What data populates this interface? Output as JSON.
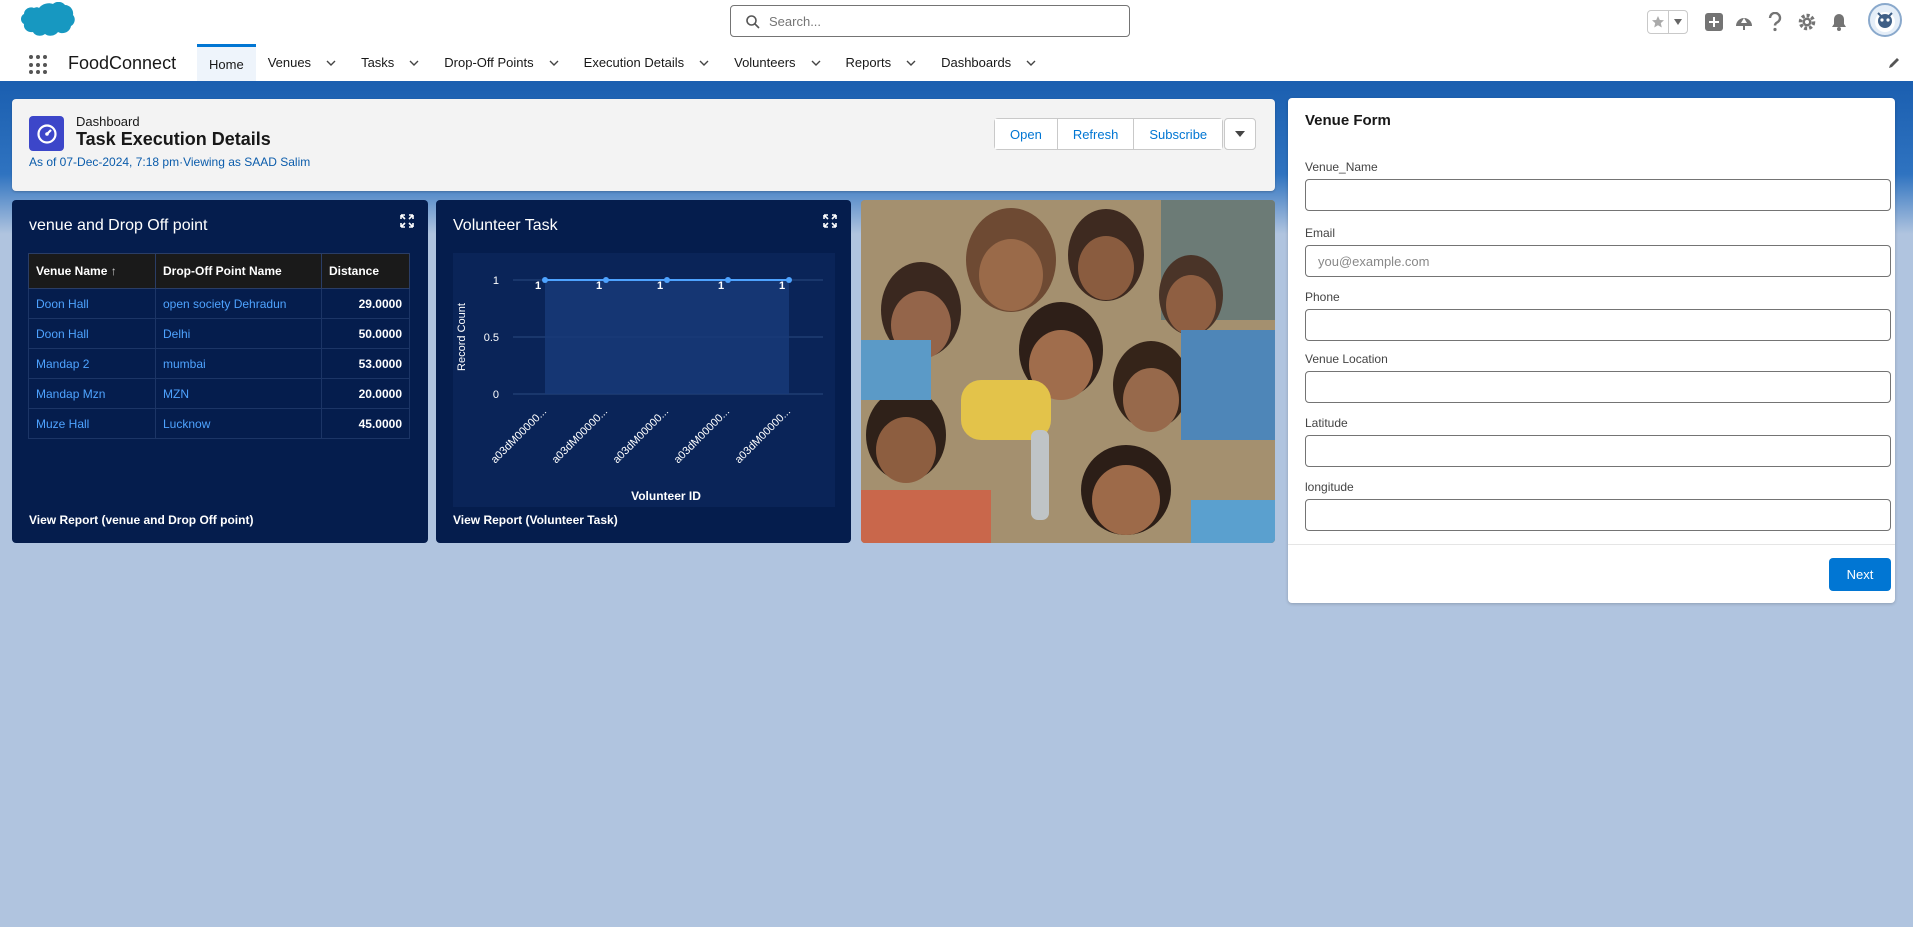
{
  "header": {
    "search_placeholder": "Search..."
  },
  "nav": {
    "app_name": "FoodConnect",
    "tabs": [
      {
        "label": "Home",
        "active": true,
        "has_menu": false
      },
      {
        "label": "Venues",
        "has_menu": true
      },
      {
        "label": "Tasks",
        "has_menu": true
      },
      {
        "label": "Drop-Off Points",
        "has_menu": true
      },
      {
        "label": "Execution Details",
        "has_menu": true
      },
      {
        "label": "Volunteers",
        "has_menu": true
      },
      {
        "label": "Reports",
        "has_menu": true
      },
      {
        "label": "Dashboards",
        "has_menu": true
      }
    ]
  },
  "dashboard": {
    "kind": "Dashboard",
    "title": "Task Execution Details",
    "subtitle": "As of 07-Dec-2024, 7:18 pm·Viewing as SAAD Salim",
    "buttons": {
      "open": "Open",
      "refresh": "Refresh",
      "subscribe": "Subscribe"
    }
  },
  "widget_table": {
    "title": "venue and Drop Off point",
    "columns": [
      "Venue Name",
      "Drop-Off Point Name",
      "Distance"
    ],
    "sort_indicator": "↑",
    "rows": [
      [
        "Doon Hall",
        "open society Dehradun",
        "29.0000"
      ],
      [
        "Doon Hall",
        "Delhi",
        "50.0000"
      ],
      [
        "Mandap 2",
        "mumbai",
        "53.0000"
      ],
      [
        "Mandap Mzn",
        "MZN",
        "20.0000"
      ],
      [
        "Muze Hall",
        "Lucknow",
        "45.0000"
      ]
    ],
    "footer": "View Report (venue and Drop Off point)"
  },
  "widget_chart": {
    "title": "Volunteer Task",
    "footer": "View Report (Volunteer Task)"
  },
  "chart_data": {
    "type": "line",
    "x": [
      "a03dM00000...",
      "a03dM00000...",
      "a03dM00000...",
      "a03dM00000...",
      "a03dM00000..."
    ],
    "series": [
      {
        "values": [
          1,
          1,
          1,
          1,
          1
        ]
      }
    ],
    "data_labels": [
      "1",
      "1",
      "1",
      "1",
      "1"
    ],
    "ylabel": "Record Count",
    "xlabel": "Volunteer ID",
    "yticks": [
      "0",
      "0.5",
      "1"
    ],
    "ylim": [
      0,
      1
    ],
    "line_color": "#4ea3ff"
  },
  "form": {
    "title": "Venue Form",
    "fields": [
      {
        "label": "Venue_Name",
        "value": "",
        "placeholder": ""
      },
      {
        "label": "Email",
        "value": "",
        "placeholder": "you@example.com"
      },
      {
        "label": "Phone",
        "value": "",
        "placeholder": ""
      },
      {
        "label": "Venue Location",
        "value": "",
        "placeholder": ""
      },
      {
        "label": "Latitude",
        "value": "",
        "placeholder": ""
      },
      {
        "label": "longitude",
        "value": "",
        "placeholder": ""
      }
    ],
    "next_label": "Next"
  },
  "colors": {
    "brand": "#0176d3",
    "widget_bg": "#051d4d",
    "dashboard_icon": "#3c46c9"
  }
}
